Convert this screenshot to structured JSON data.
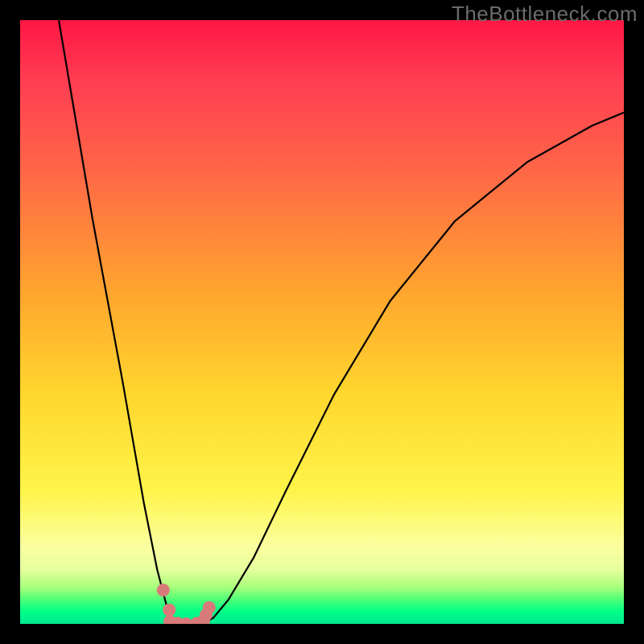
{
  "watermark": "TheBottleneck.com",
  "colors": {
    "background": "#000000",
    "gradient_top": "#ff1744",
    "gradient_mid": "#ffd72e",
    "gradient_bottom": "#00e890",
    "curve_stroke": "#000000",
    "dot_fill": "#d87a7a"
  },
  "chart_data": {
    "type": "line",
    "title": "",
    "xlabel": "",
    "ylabel": "",
    "xlim": [
      0,
      1
    ],
    "ylim": [
      0,
      1
    ],
    "series": [
      {
        "name": "left-branch",
        "x": [
          0.064,
          0.12,
          0.17,
          0.205,
          0.227,
          0.24,
          0.248,
          0.253
        ],
        "y": [
          1.0,
          0.67,
          0.4,
          0.2,
          0.09,
          0.04,
          0.01,
          0.003
        ]
      },
      {
        "name": "bottom-segment",
        "x": [
          0.253,
          0.27,
          0.29,
          0.307
        ],
        "y": [
          0.003,
          0.0,
          0.0,
          0.003
        ]
      },
      {
        "name": "right-branch",
        "x": [
          0.307,
          0.32,
          0.345,
          0.387,
          0.44,
          0.52,
          0.613,
          0.72,
          0.84,
          0.947,
          1.0
        ],
        "y": [
          0.003,
          0.01,
          0.04,
          0.11,
          0.22,
          0.38,
          0.535,
          0.667,
          0.765,
          0.825,
          0.847
        ]
      }
    ],
    "scatter_points": {
      "name": "dots",
      "x": [
        0.237,
        0.247,
        0.248,
        0.261,
        0.275,
        0.293,
        0.304,
        0.308,
        0.313
      ],
      "y": [
        0.056,
        0.023,
        0.004,
        0.001,
        0.0,
        0.001,
        0.005,
        0.015,
        0.027
      ]
    }
  }
}
